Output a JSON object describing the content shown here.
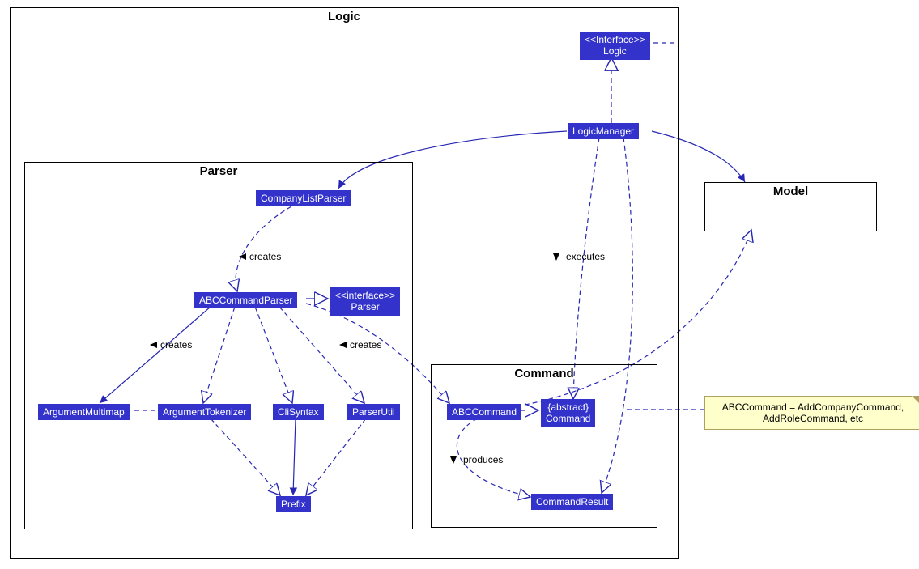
{
  "packages": {
    "logic": "Logic",
    "parser": "Parser",
    "command": "Command",
    "model": "Model"
  },
  "classes": {
    "interface_logic": "<<Interface>>\nLogic",
    "logic_manager": "LogicManager",
    "company_list_parser": "CompanyListParser",
    "abc_command_parser": "ABCCommandParser",
    "interface_parser": "<<interface>>\nParser",
    "argument_multimap": "ArgumentMultimap",
    "argument_tokenizer": "ArgumentTokenizer",
    "cli_syntax": "CliSyntax",
    "parser_util": "ParserUtil",
    "prefix": "Prefix",
    "abc_command": "ABCCommand",
    "abstract_command": "{abstract}\nCommand",
    "command_result": "CommandResult"
  },
  "labels": {
    "creates1": "creates",
    "creates2": "creates",
    "creates3": "creates",
    "executes": "executes",
    "produces": "produces"
  },
  "note": {
    "text": "ABCCommand = AddCompanyCommand,\nAddRoleCommand, etc"
  }
}
